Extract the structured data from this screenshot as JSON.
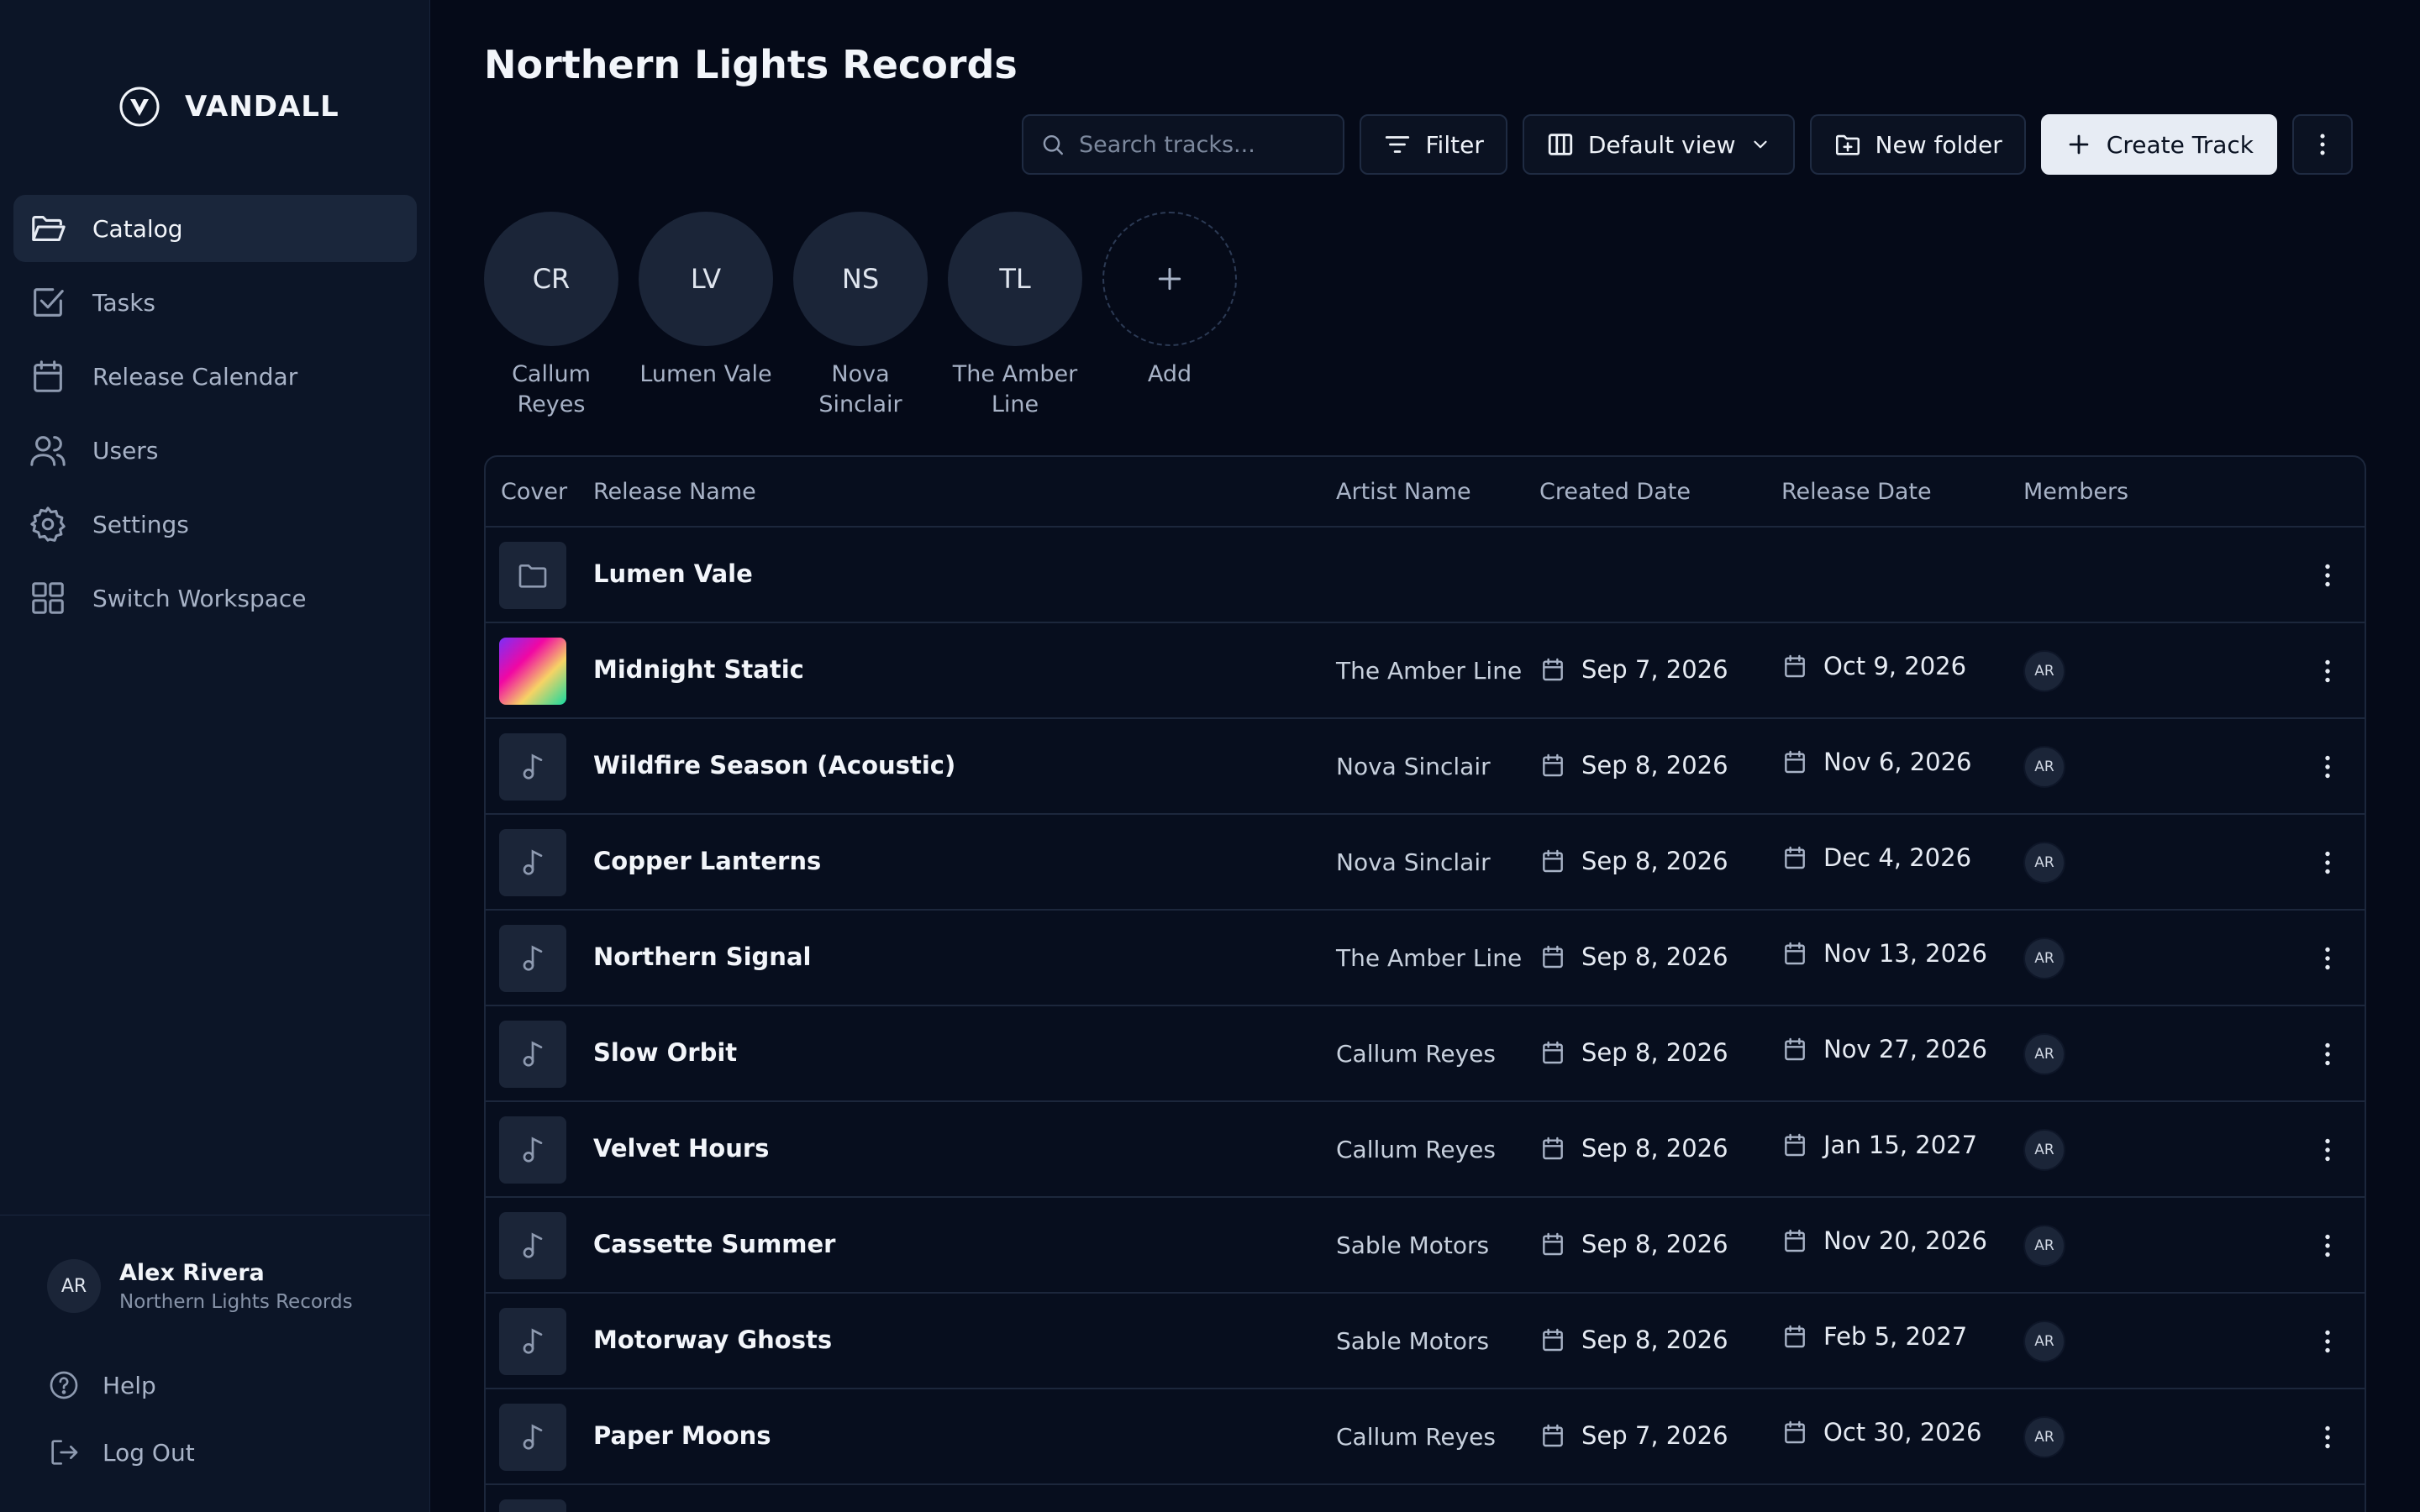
{
  "colors": {
    "background": "#050a18",
    "sidebar": "#0c1527",
    "primary_button": "#e7ecf4"
  },
  "brand": {
    "name": "VANDALL"
  },
  "sidebar": {
    "items": [
      {
        "label": "Catalog",
        "icon": "folder-open-icon",
        "active": true
      },
      {
        "label": "Tasks",
        "icon": "checkbox-icon"
      },
      {
        "label": "Release Calendar",
        "icon": "calendar-icon"
      },
      {
        "label": "Users",
        "icon": "users-icon"
      },
      {
        "label": "Settings",
        "icon": "gear-icon"
      },
      {
        "label": "Switch Workspace",
        "icon": "grid-icon"
      }
    ]
  },
  "user": {
    "initials": "AR",
    "name": "Alex Rivera",
    "org": "Northern Lights Records"
  },
  "footer": {
    "help": "Help",
    "logout": "Log Out"
  },
  "page": {
    "title": "Northern Lights Records"
  },
  "toolbar": {
    "search_placeholder": "Search tracks...",
    "filter": "Filter",
    "view": "Default view",
    "new_folder": "New folder",
    "create": "Create Track"
  },
  "artists": [
    {
      "initials": "CR",
      "name": "Callum Reyes"
    },
    {
      "initials": "LV",
      "name": "Lumen Vale"
    },
    {
      "initials": "NS",
      "name": "Nova Sinclair"
    },
    {
      "initials": "TL",
      "name": "The Amber Line"
    },
    {
      "initials": "+",
      "name": "Add"
    }
  ],
  "table": {
    "headers": {
      "cover": "Cover",
      "release": "Release Name",
      "artist": "Artist Name",
      "created": "Created Date",
      "release_date": "Release Date",
      "members": "Members"
    },
    "rows": [
      {
        "type": "folder",
        "title": "Lumen Vale",
        "artist": "",
        "created": "",
        "release": "",
        "member": ""
      },
      {
        "type": "image",
        "title": "Midnight Static",
        "artist": "The Amber Line",
        "created": "Sep 7, 2026",
        "release": "Oct 9, 2026",
        "member": "AR"
      },
      {
        "type": "track",
        "title": "Wildfire Season (Acoustic)",
        "artist": "Nova Sinclair",
        "created": "Sep 8, 2026",
        "release": "Nov 6, 2026",
        "member": "AR"
      },
      {
        "type": "track",
        "title": "Copper Lanterns",
        "artist": "Nova Sinclair",
        "created": "Sep 8, 2026",
        "release": "Dec 4, 2026",
        "member": "AR"
      },
      {
        "type": "track",
        "title": "Northern Signal",
        "artist": "The Amber Line",
        "created": "Sep 8, 2026",
        "release": "Nov 13, 2026",
        "member": "AR"
      },
      {
        "type": "track",
        "title": "Slow Orbit",
        "artist": "Callum Reyes",
        "created": "Sep 8, 2026",
        "release": "Nov 27, 2026",
        "member": "AR"
      },
      {
        "type": "track",
        "title": "Velvet Hours",
        "artist": "Callum Reyes",
        "created": "Sep 8, 2026",
        "release": "Jan 15, 2027",
        "member": "AR"
      },
      {
        "type": "track",
        "title": "Cassette Summer",
        "artist": "Sable Motors",
        "created": "Sep 8, 2026",
        "release": "Nov 20, 2026",
        "member": "AR"
      },
      {
        "type": "track",
        "title": "Motorway Ghosts",
        "artist": "Sable Motors",
        "created": "Sep 8, 2026",
        "release": "Feb 5, 2027",
        "member": "AR"
      },
      {
        "type": "track",
        "title": "Paper Moons",
        "artist": "Callum Reyes",
        "created": "Sep 7, 2026",
        "release": "Oct 30, 2026",
        "member": "AR"
      },
      {
        "type": "track",
        "title": "",
        "artist": "",
        "created": "",
        "release": "",
        "member": ""
      }
    ]
  }
}
